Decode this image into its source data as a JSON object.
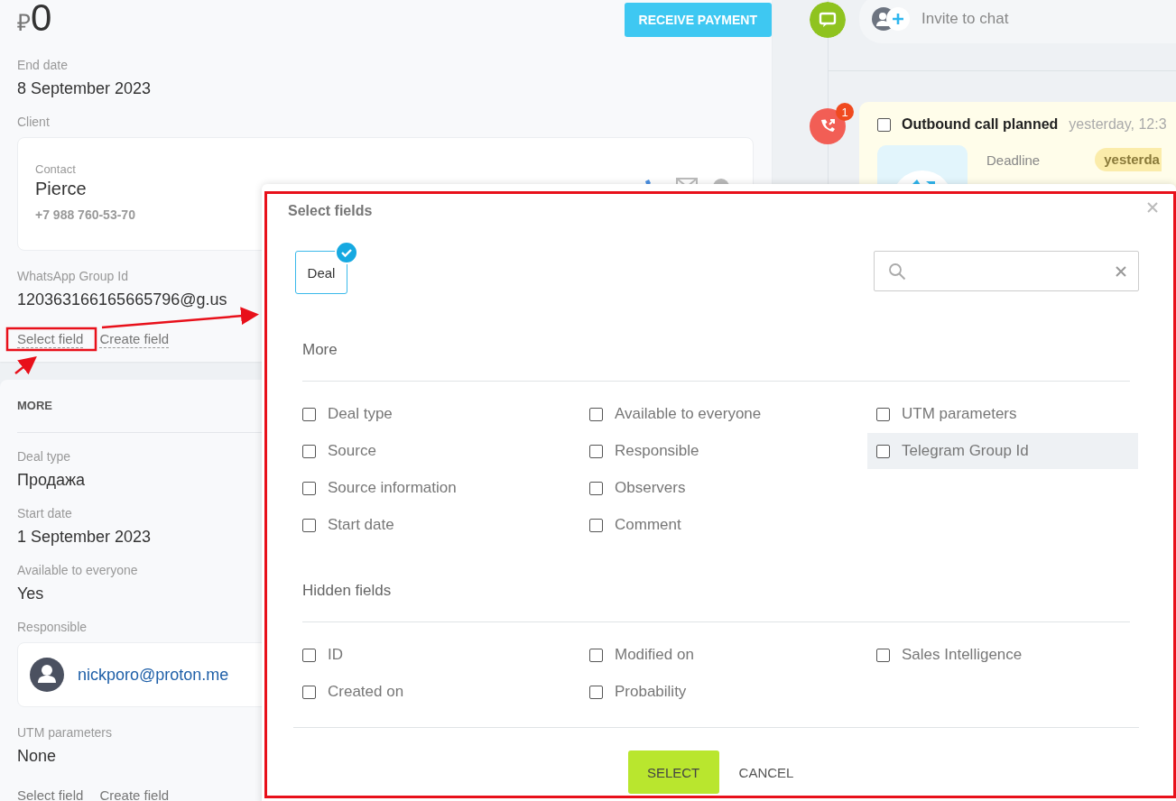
{
  "deal": {
    "currency": "₽",
    "amount": "0",
    "receive_payment_button": "RECEIVE PAYMENT",
    "fields": [
      {
        "label": "End date",
        "value": "8 September 2023"
      }
    ],
    "client": {
      "label": "Client",
      "contact_label": "Contact",
      "name": "Pierce",
      "phone": "+7 988 760-53-70"
    },
    "extra_fields": [
      {
        "label": "WhatsApp Group Id",
        "value": "120363166165665796@g.us"
      }
    ],
    "links": [
      "Select field",
      "Create field"
    ]
  },
  "more": {
    "title": "MORE",
    "fields": [
      {
        "kind": "text",
        "label": "Deal type",
        "value": "Продажа"
      },
      {
        "kind": "text",
        "label": "Start date",
        "value": "1 September 2023"
      },
      {
        "kind": "text",
        "label": "Available to everyone",
        "value": "Yes"
      },
      {
        "kind": "user",
        "label": "Responsible",
        "value": "nickporo@proton.me"
      },
      {
        "kind": "text",
        "label": "UTM parameters",
        "value": "None"
      }
    ],
    "links": [
      "Select field",
      "Create field"
    ]
  },
  "timeline": {
    "invite": "Invite to chat",
    "call": {
      "badge": "1",
      "checked": false,
      "title": "Outbound call planned",
      "time": "yesterday, 12:3",
      "deadline_label": "Deadline",
      "deadline_value": "yesterda"
    }
  },
  "modal": {
    "title": "Select fields",
    "entities": [
      {
        "label": "Deal",
        "selected": true
      }
    ],
    "sections": [
      {
        "title": "More",
        "items": [
          {
            "label": "Deal type",
            "checked": false,
            "hovered": false
          },
          {
            "label": "Source",
            "checked": false,
            "hovered": false
          },
          {
            "label": "Source information",
            "checked": false,
            "hovered": false
          },
          {
            "label": "Start date",
            "checked": false,
            "hovered": false
          },
          {
            "label": "Available to everyone",
            "checked": false,
            "hovered": false
          },
          {
            "label": "Responsible",
            "checked": false,
            "hovered": false
          },
          {
            "label": "Observers",
            "checked": false,
            "hovered": false
          },
          {
            "label": "Comment",
            "checked": false,
            "hovered": false
          },
          {
            "label": "UTM parameters",
            "checked": false,
            "hovered": false
          },
          {
            "label": "Telegram Group Id",
            "checked": false,
            "hovered": true
          }
        ]
      },
      {
        "title": "Hidden fields",
        "items": [
          {
            "label": "ID",
            "checked": false,
            "hovered": false
          },
          {
            "label": "Created on",
            "checked": false,
            "hovered": false
          },
          {
            "label": "Modified on",
            "checked": false,
            "hovered": false
          },
          {
            "label": "Probability",
            "checked": false,
            "hovered": false
          },
          {
            "label": "Sales Intelligence",
            "checked": false,
            "hovered": false
          }
        ]
      }
    ],
    "buttons": {
      "select": "SELECT",
      "cancel": "CANCEL"
    }
  }
}
